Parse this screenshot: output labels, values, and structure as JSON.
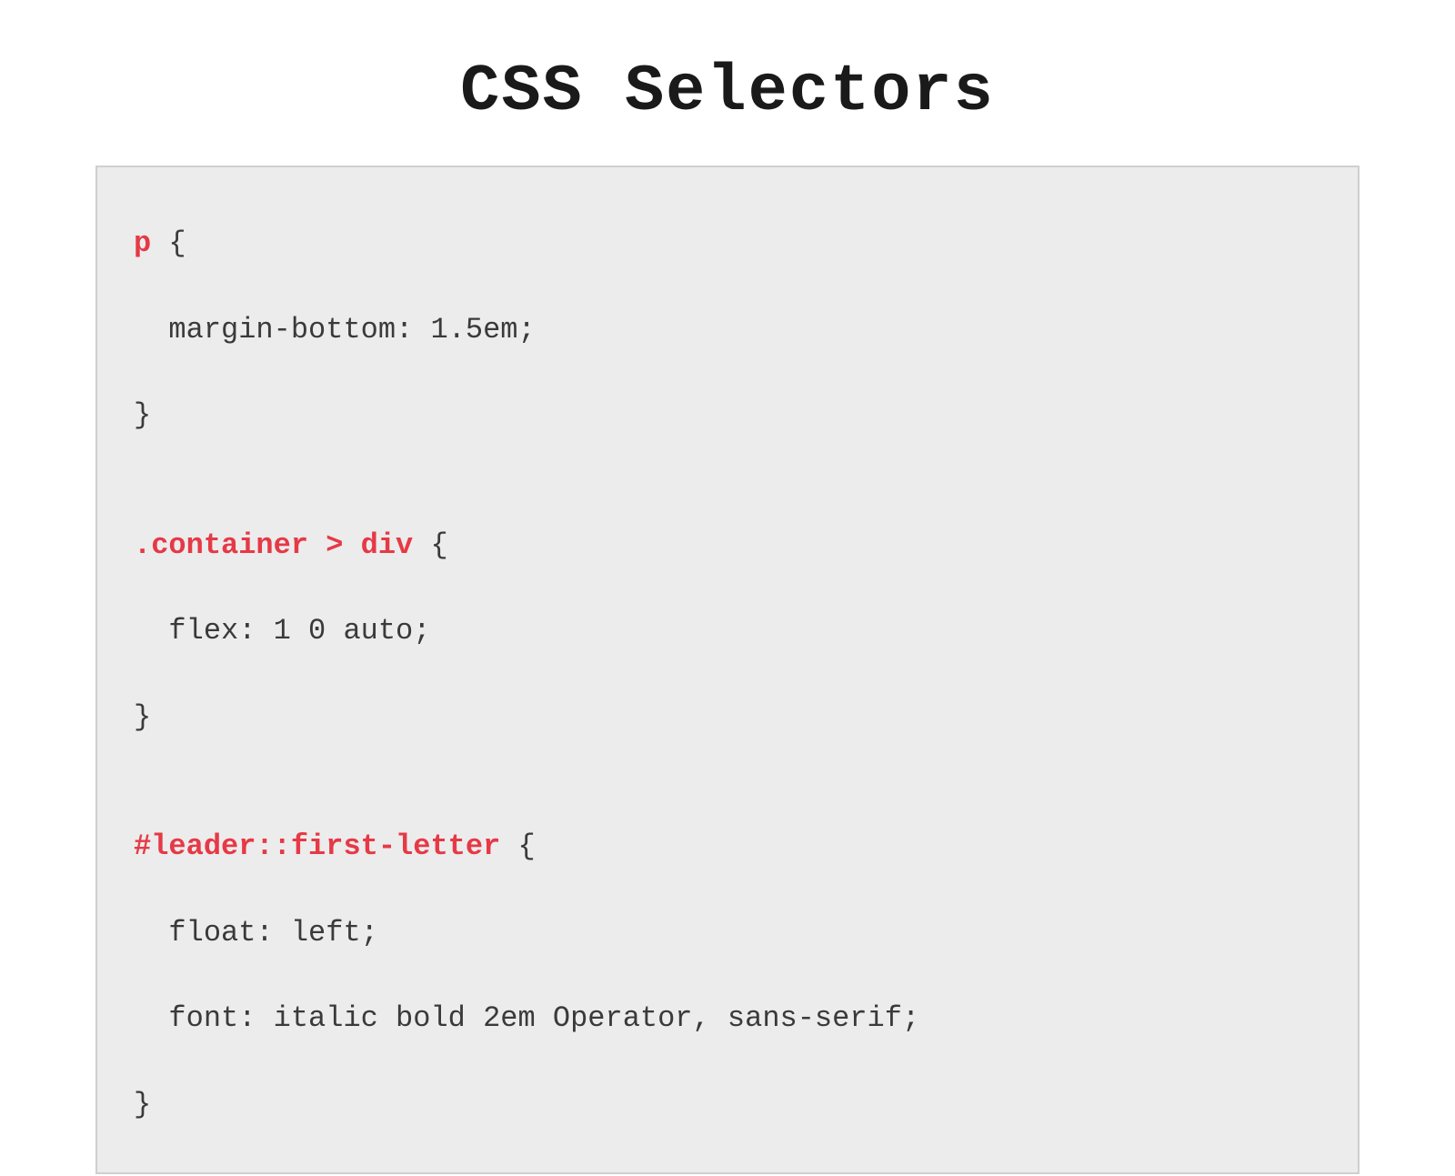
{
  "title": "CSS Selectors",
  "code": {
    "rules": [
      {
        "selector": "p",
        "open": " {",
        "declarations": [
          "  margin-bottom: 1.5em;"
        ],
        "close": "}"
      },
      {
        "selector": ".container > div",
        "open": " {",
        "declarations": [
          "  flex: 1 0 auto;"
        ],
        "close": "}"
      },
      {
        "selector": "#leader::first-letter",
        "open": " {",
        "declarations": [
          "  float: left;",
          "  font: italic bold 2em Operator, sans-serif;"
        ],
        "close": "}"
      }
    ]
  }
}
